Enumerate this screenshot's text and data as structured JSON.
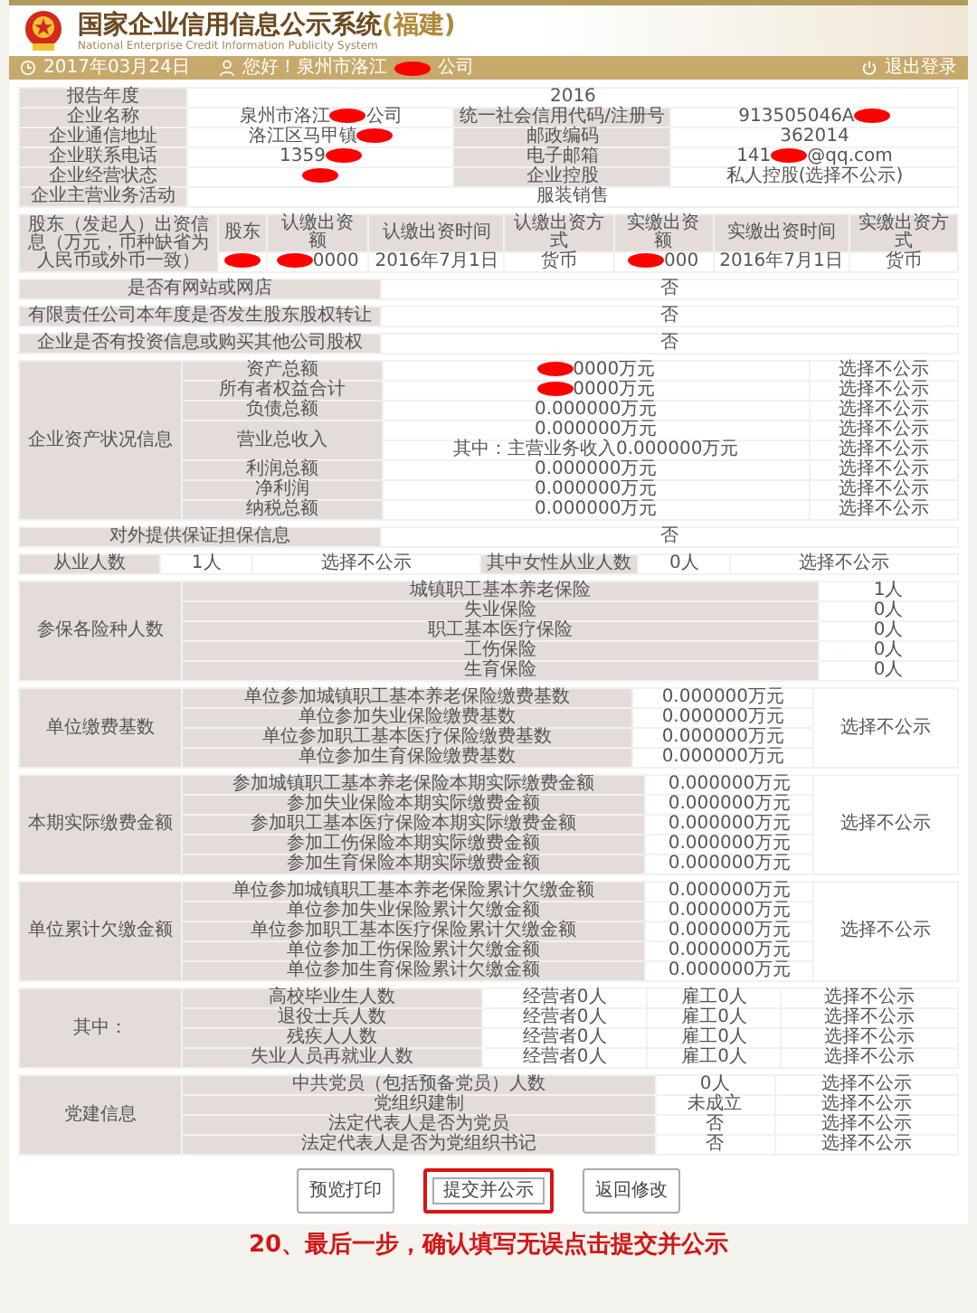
{
  "header": {
    "title": "国家企业信用信息公示系统",
    "region": "(福建)",
    "subtitle": "National Enterprise Credit Information Publicity System"
  },
  "user_bar": {
    "date": "2017年03月24日",
    "greeting": {
      "redacted": true,
      "before": "您好！泉州市洛江",
      "after": "公司"
    },
    "logout": "退出登录"
  },
  "sections": [
    {
      "kind": "pairs",
      "rows": [
        [
          {
            "label": "报告年度",
            "value": "2016"
          }
        ],
        [
          {
            "label": "企业名称",
            "value": {
              "redacted": true,
              "before": "泉州市洛江",
              "after": "公司"
            }
          },
          {
            "label": "统一社会信用代码/注册号",
            "value": {
              "redacted": true,
              "before": "913505046A"
            }
          }
        ],
        [
          {
            "label": "企业通信地址",
            "value": {
              "redacted": true,
              "before": "洛江区马甲镇"
            }
          },
          {
            "label": "邮政编码",
            "value": "362014"
          }
        ],
        [
          {
            "label": "企业联系电话",
            "value": {
              "redacted": true,
              "before": "1359"
            }
          },
          {
            "label": "电子邮箱",
            "value": {
              "redacted": true,
              "before": "141",
              "after": "@qq.com"
            }
          }
        ],
        [
          {
            "label": "企业经营状态",
            "value": {
              "redacted": true
            }
          },
          {
            "label": "企业控股",
            "value": "私人控股(选择不公示)"
          }
        ],
        [
          {
            "label": "企业主营业务活动",
            "value": "服装销售"
          }
        ]
      ]
    },
    {
      "kind": "table",
      "title": "股东（发起人）出资信息（万元，币种缺省为人民币或外币一致）",
      "columns": [
        "股东",
        "认缴出资额",
        "认缴出资时间",
        "认缴出资方式",
        "实缴出资额",
        "实缴出资时间",
        "实缴出资方式"
      ],
      "rows": [
        [
          {
            "redacted": true
          },
          {
            "redacted": true,
            "after": "0000"
          },
          "2016年7月1日",
          "货币",
          {
            "redacted": true,
            "after": "000"
          },
          "2016年7月1日",
          "货币"
        ]
      ]
    },
    {
      "kind": "single",
      "label": "是否有网站或网店",
      "value": "否"
    },
    {
      "kind": "single",
      "label": "有限责任公司本年度是否发生股东股权转让",
      "value": "否"
    },
    {
      "kind": "single",
      "label": "企业是否有投资信息或购买其他公司股权",
      "value": "否"
    },
    {
      "kind": "group",
      "title": "企业资产状况信息",
      "items": [
        {
          "label": "资产总额",
          "value": {
            "redacted": true,
            "after": "0000万元"
          },
          "privacy": "选择不公示"
        },
        {
          "label": "所有者权益合计",
          "value": {
            "redacted": true,
            "after": "0000万元"
          },
          "privacy": "选择不公示"
        },
        {
          "label": "负债总额",
          "value": "0.000000万元",
          "privacy": "选择不公示"
        },
        {
          "label": "营业总收入",
          "lines": [
            {
              "value": "0.000000万元",
              "privacy": "选择不公示"
            },
            {
              "value": "其中：主营业务收入0.000000万元",
              "privacy": "选择不公示"
            }
          ]
        },
        {
          "label": "利润总额",
          "value": "0.000000万元",
          "privacy": "选择不公示"
        },
        {
          "label": "净利润",
          "value": "0.000000万元",
          "privacy": "选择不公示"
        },
        {
          "label": "纳税总额",
          "value": "0.000000万元",
          "privacy": "选择不公示"
        }
      ]
    },
    {
      "kind": "single",
      "label": "对外提供保证担保信息",
      "value": "否"
    },
    {
      "kind": "pairs",
      "rows": [
        [
          {
            "label": "从业人数",
            "value": "1人",
            "privacy": "选择不公示"
          },
          {
            "label": "其中女性从业人数",
            "value": "0人",
            "privacy": "选择不公示"
          }
        ]
      ]
    },
    {
      "kind": "group",
      "title": "参保各险种人数",
      "items": [
        {
          "label": "城镇职工基本养老保险",
          "value": "1人"
        },
        {
          "label": "失业保险",
          "value": "0人"
        },
        {
          "label": "职工基本医疗保险",
          "value": "0人"
        },
        {
          "label": "工伤保险",
          "value": "0人"
        },
        {
          "label": "生育保险",
          "value": "0人"
        }
      ]
    },
    {
      "kind": "group",
      "title": "单位缴费基数",
      "privacy": "选择不公示",
      "items": [
        {
          "label": "单位参加城镇职工基本养老保险缴费基数",
          "value": "0.000000万元"
        },
        {
          "label": "单位参加失业保险缴费基数",
          "value": "0.000000万元"
        },
        {
          "label": "单位参加职工基本医疗保险缴费基数",
          "value": "0.000000万元"
        },
        {
          "label": "单位参加生育保险缴费基数",
          "value": "0.000000万元"
        }
      ]
    },
    {
      "kind": "group",
      "title": "本期实际缴费金额",
      "privacy": "选择不公示",
      "items": [
        {
          "label": "参加城镇职工基本养老保险本期实际缴费金额",
          "value": "0.000000万元"
        },
        {
          "label": "参加失业保险本期实际缴费金额",
          "value": "0.000000万元"
        },
        {
          "label": "参加职工基本医疗保险本期实际缴费金额",
          "value": "0.000000万元"
        },
        {
          "label": "参加工伤保险本期实际缴费金额",
          "value": "0.000000万元"
        },
        {
          "label": "参加生育保险本期实际缴费金额",
          "value": "0.000000万元"
        }
      ]
    },
    {
      "kind": "group",
      "title": "单位累计欠缴金额",
      "privacy": "选择不公示",
      "items": [
        {
          "label": "单位参加城镇职工基本养老保险累计欠缴金额",
          "value": "0.000000万元"
        },
        {
          "label": "单位参加失业保险累计欠缴金额",
          "value": "0.000000万元"
        },
        {
          "label": "单位参加职工基本医疗保险累计欠缴金额",
          "value": "0.000000万元"
        },
        {
          "label": "单位参加工伤保险累计欠缴金额",
          "value": "0.000000万元"
        },
        {
          "label": "单位参加生育保险累计欠缴金额",
          "value": "0.000000万元"
        }
      ]
    },
    {
      "kind": "group",
      "title": "其中：",
      "items": [
        {
          "label": "高校毕业生人数",
          "values": [
            "经营者0人",
            "雇工0人"
          ],
          "privacy": "选择不公示"
        },
        {
          "label": "退役士兵人数",
          "values": [
            "经营者0人",
            "雇工0人"
          ],
          "privacy": "选择不公示"
        },
        {
          "label": "残疾人人数",
          "values": [
            "经营者0人",
            "雇工0人"
          ],
          "privacy": "选择不公示"
        },
        {
          "label": "失业人员再就业人数",
          "values": [
            "经营者0人",
            "雇工0人"
          ],
          "privacy": "选择不公示"
        }
      ]
    },
    {
      "kind": "group",
      "title": "党建信息",
      "items": [
        {
          "label": "中共党员（包括预备党员）人数",
          "value": "0人",
          "privacy": "选择不公示"
        },
        {
          "label": "党组织建制",
          "value": "未成立",
          "privacy": "选择不公示"
        },
        {
          "label": "法定代表人是否为党员",
          "value": "否",
          "privacy": "选择不公示"
        },
        {
          "label": "法定代表人是否为党组织书记",
          "value": "否",
          "privacy": "选择不公示"
        }
      ]
    }
  ],
  "buttons": [
    {
      "label": "预览打印",
      "highlighted": false
    },
    {
      "label": "提交并公示",
      "highlighted": true
    },
    {
      "label": "返回修改",
      "highlighted": false
    }
  ],
  "annotation": "20、最后一步，确认填写无误点击提交并公示"
}
